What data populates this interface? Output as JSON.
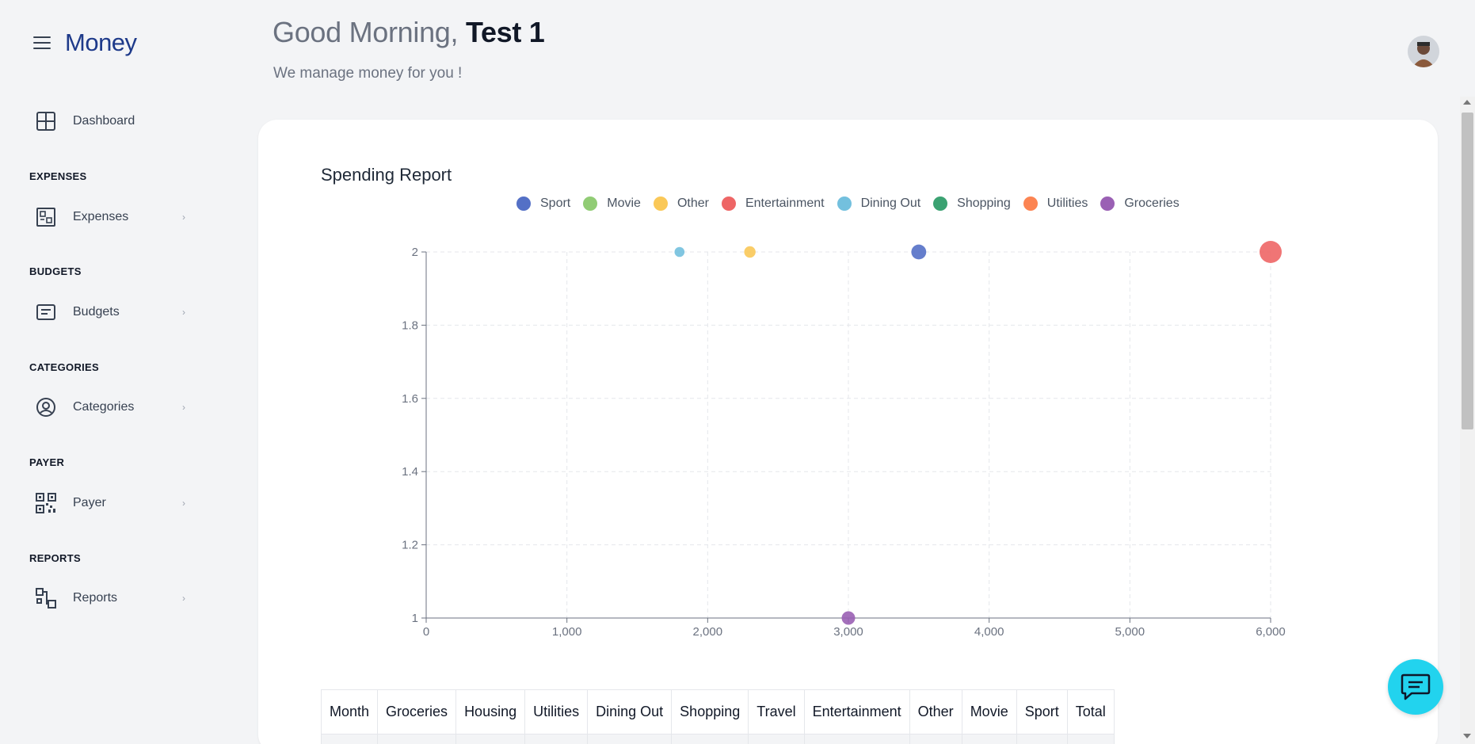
{
  "app": {
    "name": "Money"
  },
  "sidebar": {
    "dashboard": {
      "label": "Dashboard",
      "icon": "dashboard-grid-icon"
    },
    "sections": [
      {
        "heading": "EXPENSES",
        "item": {
          "label": "Expenses",
          "icon": "expenses-icon"
        }
      },
      {
        "heading": "BUDGETS",
        "item": {
          "label": "Budgets",
          "icon": "budget-icon"
        }
      },
      {
        "heading": "CATEGORIES",
        "item": {
          "label": "Categories",
          "icon": "user-circle-icon"
        }
      },
      {
        "heading": "PAYER",
        "item": {
          "label": "Payer",
          "icon": "qr-code-icon"
        }
      },
      {
        "heading": "REPORTS",
        "item": {
          "label": "Reports",
          "icon": "reports-icon"
        }
      }
    ]
  },
  "header": {
    "greeting": "Good Morning,",
    "user_name": "Test 1",
    "subtitle": "We manage money for you !"
  },
  "chart_data": {
    "type": "scatter",
    "title": "Spending Report",
    "xlabel": "",
    "ylabel": "",
    "xlim": [
      0,
      6000
    ],
    "ylim": [
      1,
      2
    ],
    "x_ticks": [
      "0",
      "1,000",
      "2,000",
      "3,000",
      "4,000",
      "5,000",
      "6,000"
    ],
    "y_ticks": [
      "1",
      "1.2",
      "1.4",
      "1.6",
      "1.8",
      "2"
    ],
    "grid": true,
    "legend_position": "top-center",
    "series": [
      {
        "name": "Sport",
        "color": "#5470c6",
        "points": [
          {
            "x": 3500,
            "y": 2
          }
        ]
      },
      {
        "name": "Movie",
        "color": "#91cc75",
        "points": []
      },
      {
        "name": "Other",
        "color": "#fac858",
        "points": [
          {
            "x": 2300,
            "y": 2
          }
        ]
      },
      {
        "name": "Entertainment",
        "color": "#ee6666",
        "points": [
          {
            "x": 6000,
            "y": 2
          }
        ]
      },
      {
        "name": "Dining Out",
        "color": "#73c0de",
        "points": [
          {
            "x": 1800,
            "y": 2
          }
        ]
      },
      {
        "name": "Shopping",
        "color": "#3ba272",
        "points": []
      },
      {
        "name": "Utilities",
        "color": "#fc8452",
        "points": []
      },
      {
        "name": "Groceries",
        "color": "#9a60b4",
        "points": [
          {
            "x": 3000,
            "y": 1
          }
        ]
      }
    ]
  },
  "table": {
    "headers": [
      "Month",
      "Groceries",
      "Housing",
      "Utilities",
      "Dining Out",
      "Shopping",
      "Travel",
      "Entertainment",
      "Other",
      "Movie",
      "Sport",
      "Total"
    ]
  },
  "chat": {
    "icon": "chat-icon"
  }
}
